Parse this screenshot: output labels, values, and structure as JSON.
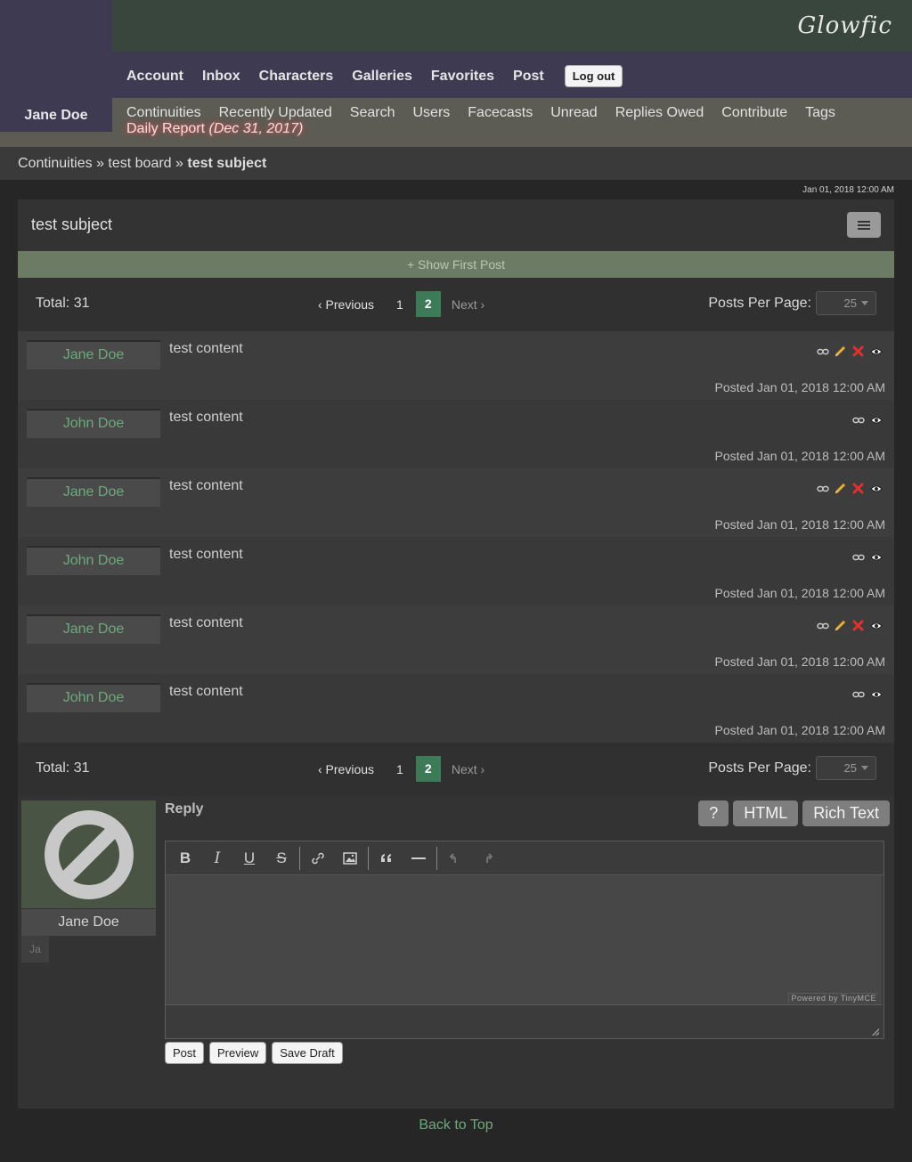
{
  "header": {
    "logo": "Glowfic",
    "user_name": "Jane Doe",
    "nav": [
      "Account",
      "Inbox",
      "Characters",
      "Galleries",
      "Favorites",
      "Post"
    ],
    "logout_label": "Log out",
    "subnav": [
      "Continuities",
      "Recently Updated",
      "Search",
      "Users",
      "Facecasts",
      "Unread",
      "Replies Owed",
      "Contribute",
      "Tags"
    ],
    "daily_report": "Daily Report",
    "daily_report_date": "(Dec 31, 2017)"
  },
  "breadcrumb": {
    "c1": "Continuities",
    "c2": "test board",
    "c3": "test subject",
    "sep": "»"
  },
  "timestamp": "Jan 01, 2018 12:00 AM",
  "post": {
    "subject": "test subject",
    "show_first": "+ Show First Post"
  },
  "pagination": {
    "total": "Total: 31",
    "prev": "‹ Previous",
    "page1": "1",
    "current": "2",
    "next": "Next ›",
    "per_page_label": "Posts Per Page:",
    "per_page_value": "25"
  },
  "replies": [
    {
      "author": "Jane Doe",
      "content": "test content",
      "posted": "Posted Jan 01, 2018 12:00 AM",
      "editable": true
    },
    {
      "author": "John Doe",
      "content": "test content",
      "posted": "Posted Jan 01, 2018 12:00 AM",
      "editable": false
    },
    {
      "author": "Jane Doe",
      "content": "test content",
      "posted": "Posted Jan 01, 2018 12:00 AM",
      "editable": true
    },
    {
      "author": "John Doe",
      "content": "test content",
      "posted": "Posted Jan 01, 2018 12:00 AM",
      "editable": false
    },
    {
      "author": "Jane Doe",
      "content": "test content",
      "posted": "Posted Jan 01, 2018 12:00 AM",
      "editable": true
    },
    {
      "author": "John Doe",
      "content": "test content",
      "posted": "Posted Jan 01, 2018 12:00 AM",
      "editable": false
    }
  ],
  "reply_form": {
    "label": "Reply",
    "help": "?",
    "html": "HTML",
    "rich": "Rich Text",
    "character_name": "Jane Doe",
    "alias": "Ja",
    "powered": "Powered by TinyMCE",
    "post_btn": "Post",
    "preview_btn": "Preview",
    "draft_btn": "Save Draft"
  },
  "toolbar": {
    "bold": "B",
    "italic": "I",
    "underline": "U",
    "strike": "S"
  },
  "footer": {
    "back_to_top": "Back to Top"
  },
  "colors": {
    "accent_green": "#3d7a57",
    "author_green": "#6ea87d",
    "header_purple": "#3d3a52"
  }
}
